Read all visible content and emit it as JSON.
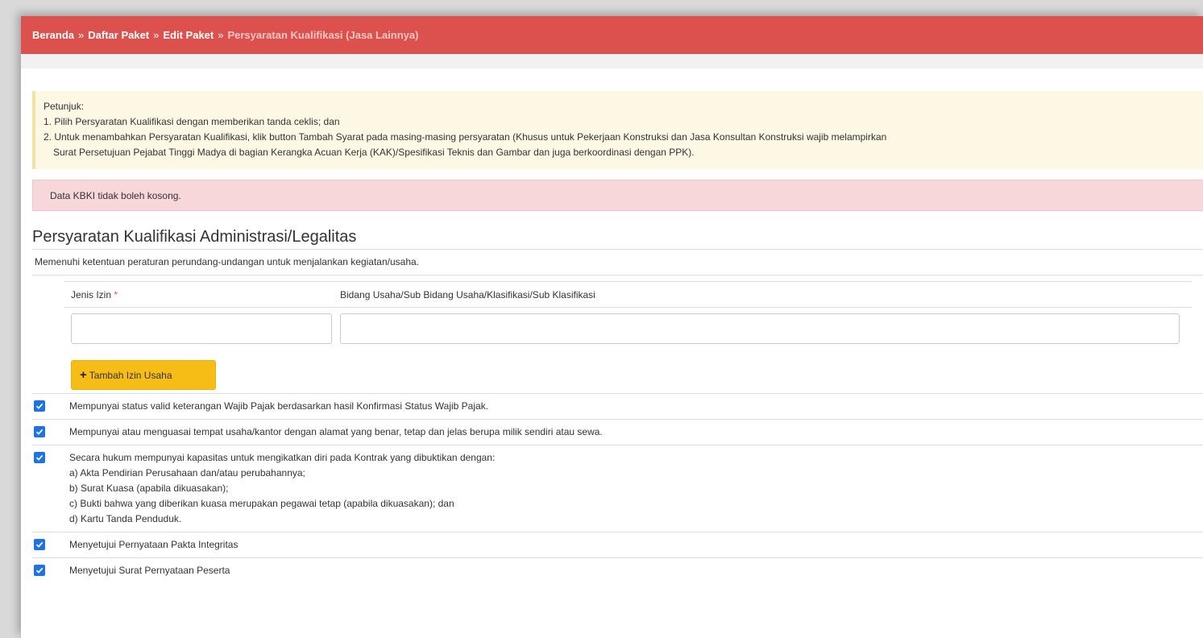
{
  "breadcrumb": {
    "home": "Beranda",
    "sep": "»",
    "list": "Daftar Paket",
    "edit": "Edit Paket",
    "current": "Persyaratan Kualifikasi (Jasa Lainnya)"
  },
  "notice": {
    "title": "Petunjuk:",
    "line1": "1. Pilih Persyaratan Kualifikasi dengan memberikan tanda ceklis; dan",
    "line2": "2. Untuk menambahkan Persyaratan Kualifikasi, klik button Tambah Syarat pada masing-masing persyaratan (Khusus untuk Pekerjaan Konstruksi dan Jasa Konsultan Konstruksi wajib melampirkan",
    "line3": "Surat Persetujuan Pejabat Tinggi Madya di bagian Kerangka Acuan Kerja (KAK)/Spesifikasi Teknis dan Gambar dan juga berkoordinasi dengan PPK)."
  },
  "alert": "Data KBKI tidak boleh kosong.",
  "section": {
    "title": "Persyaratan Kualifikasi Administrasi/Legalitas",
    "desc": "Memenuhi ketentuan peraturan perundang-undangan untuk menjalankan kegiatan/usaha."
  },
  "izin": {
    "col1": "Jenis Izin",
    "required_mark": "*",
    "col2": "Bidang Usaha/Sub Bidang Usaha/Klasifikasi/Sub Klasifikasi",
    "input1_value": "",
    "input2_value": "",
    "add_button": "Tambah Izin Usaha"
  },
  "checklist": [
    {
      "checked": true,
      "lines": [
        "Mempunyai status valid keterangan Wajib Pajak berdasarkan hasil Konfirmasi Status Wajib Pajak."
      ]
    },
    {
      "checked": true,
      "lines": [
        "Mempunyai atau menguasai tempat usaha/kantor dengan alamat yang benar, tetap dan jelas berupa milik sendiri atau sewa."
      ]
    },
    {
      "checked": true,
      "lines": [
        "Secara hukum mempunyai kapasitas untuk mengikatkan diri pada Kontrak yang dibuktikan dengan:",
        "a) Akta Pendirian Perusahaan dan/atau perubahannya;",
        "b) Surat Kuasa (apabila dikuasakan);",
        "c) Bukti bahwa yang diberikan kuasa merupakan pegawai tetap (apabila dikuasakan); dan",
        "d) Kartu Tanda Penduduk."
      ]
    },
    {
      "checked": true,
      "lines": [
        "Menyetujui Pernyataan Pakta Integritas"
      ]
    },
    {
      "checked": true,
      "lines": [
        "Menyetujui Surat Pernyataan Peserta"
      ]
    }
  ],
  "colors": {
    "header": "#dc514d",
    "button": "#f6bd16",
    "checkbox": "#1a73e8"
  }
}
